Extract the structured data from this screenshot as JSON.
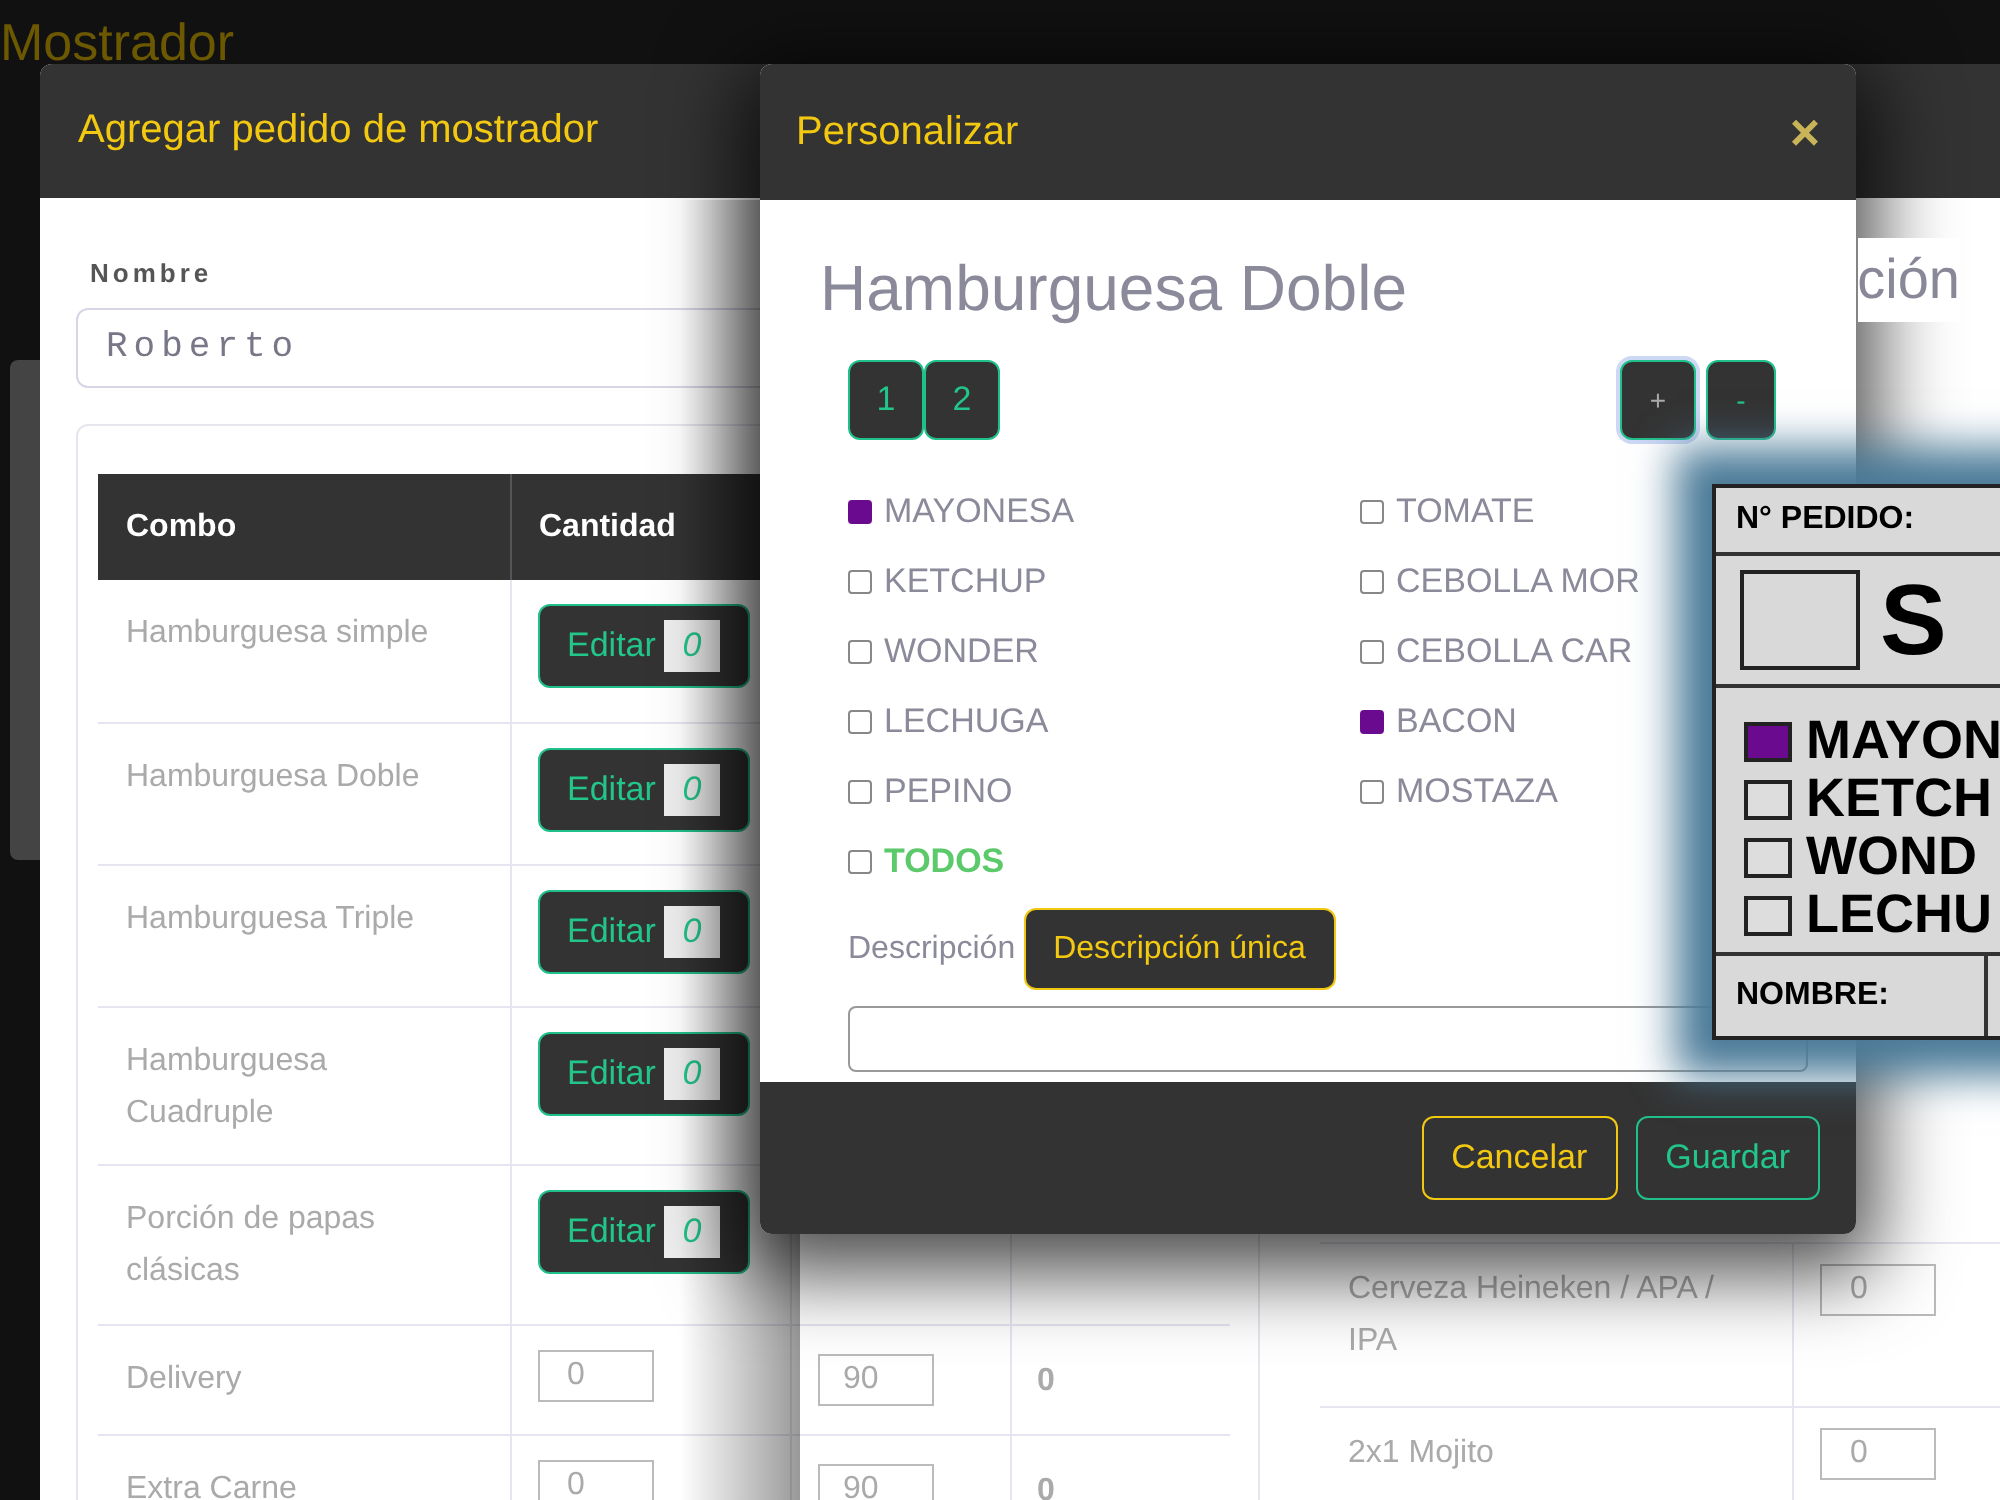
{
  "background": {
    "title": "Mostrador"
  },
  "order_modal": {
    "title": "Agregar pedido de mostrador",
    "name_label": "Nombre",
    "name_value": "Roberto",
    "section_title_fragment": "ción",
    "table": {
      "columns": [
        "Combo",
        "Cantidad"
      ],
      "rows": [
        {
          "combo": "Hamburguesa simple",
          "kind": "editable",
          "button": "Editar",
          "quantity": "0"
        },
        {
          "combo": "Hamburguesa Doble",
          "kind": "editable",
          "button": "Editar",
          "quantity": "0"
        },
        {
          "combo": "Hamburguesa Triple",
          "kind": "editable",
          "button": "Editar",
          "quantity": "0"
        },
        {
          "combo": "Hamburguesa Cuadruple",
          "kind": "editable",
          "button": "Editar",
          "quantity": "0"
        },
        {
          "combo": "Porción de papas clásicas",
          "kind": "editable",
          "button": "Editar",
          "quantity": "0"
        },
        {
          "combo": "Delivery",
          "kind": "plain",
          "quantity": "0",
          "column_3": "90",
          "column_4": "0"
        },
        {
          "combo": "Extra Carne",
          "kind": "plain",
          "quantity": "0",
          "column_3": "90",
          "column_4": "0"
        }
      ]
    },
    "side_table": {
      "rows": [
        {
          "name": "Cerveza Heineken / APA / IPA",
          "quantity": "0"
        },
        {
          "name": "2x1 Mojito",
          "quantity": "0"
        }
      ]
    }
  },
  "customize_modal": {
    "title": "Personalizar",
    "close": "×",
    "product": "Hamburguesa Doble",
    "units": [
      {
        "label": "1"
      },
      {
        "label": "2"
      }
    ],
    "add": "+",
    "remove": "-",
    "options": [
      {
        "label": "MAYONESA",
        "checked": true
      },
      {
        "label": "TOMATE",
        "checked": false
      },
      {
        "label": "KETCHUP",
        "checked": false
      },
      {
        "label": "CEBOLLA MOR",
        "checked": false
      },
      {
        "label": "WONDER",
        "checked": false
      },
      {
        "label": "CEBOLLA CAR",
        "checked": false
      },
      {
        "label": "LECHUGA",
        "checked": false
      },
      {
        "label": "BACON",
        "checked": true
      },
      {
        "label": "PEPINO",
        "checked": false
      },
      {
        "label": "MOSTAZA",
        "checked": false
      }
    ],
    "all_option": {
      "label": "TODOS",
      "checked": false
    },
    "description_label": "Descripción",
    "description_button": "Descripción única",
    "cancel": "Cancelar",
    "save": "Guardar"
  },
  "ticket": {
    "order_label": "N° PEDIDO:",
    "size": "S",
    "items": [
      {
        "label": "MAYON",
        "checked": true
      },
      {
        "label": "KETCH",
        "checked": false
      },
      {
        "label": "WOND",
        "checked": false
      },
      {
        "label": "LECHU",
        "checked": false
      }
    ],
    "name_label": "NOMBRE:"
  }
}
